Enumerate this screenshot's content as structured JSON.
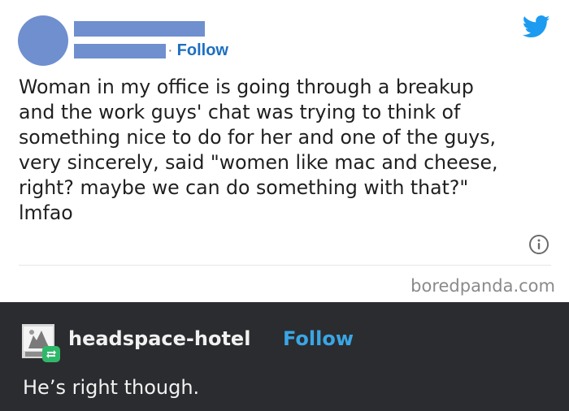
{
  "tweet": {
    "follow_separator": "·",
    "follow_label": "Follow",
    "text": "Woman in my office is going through a breakup\nand the work guys' chat was trying to think of\nsomething nice to do for her and one of the guys,\nvery sincerely, said \"women like mac and cheese,\nright? maybe we can do something with that?\"\nlmfao",
    "watermark": "boredpanda.com"
  },
  "reply": {
    "username": "headspace-hotel",
    "follow_label": "Follow",
    "text": "He’s right though."
  },
  "colors": {
    "redaction": "#6f8fcf",
    "twitter_blue": "#1d9bf0",
    "tumblr_bg": "#2b2c2f",
    "tumblr_follow": "#3aa6e6",
    "reblog_green": "#2fb86a"
  },
  "icons": {
    "brand": "twitter-bird-icon",
    "info": "info-icon",
    "reblog": "reblog-icon"
  }
}
